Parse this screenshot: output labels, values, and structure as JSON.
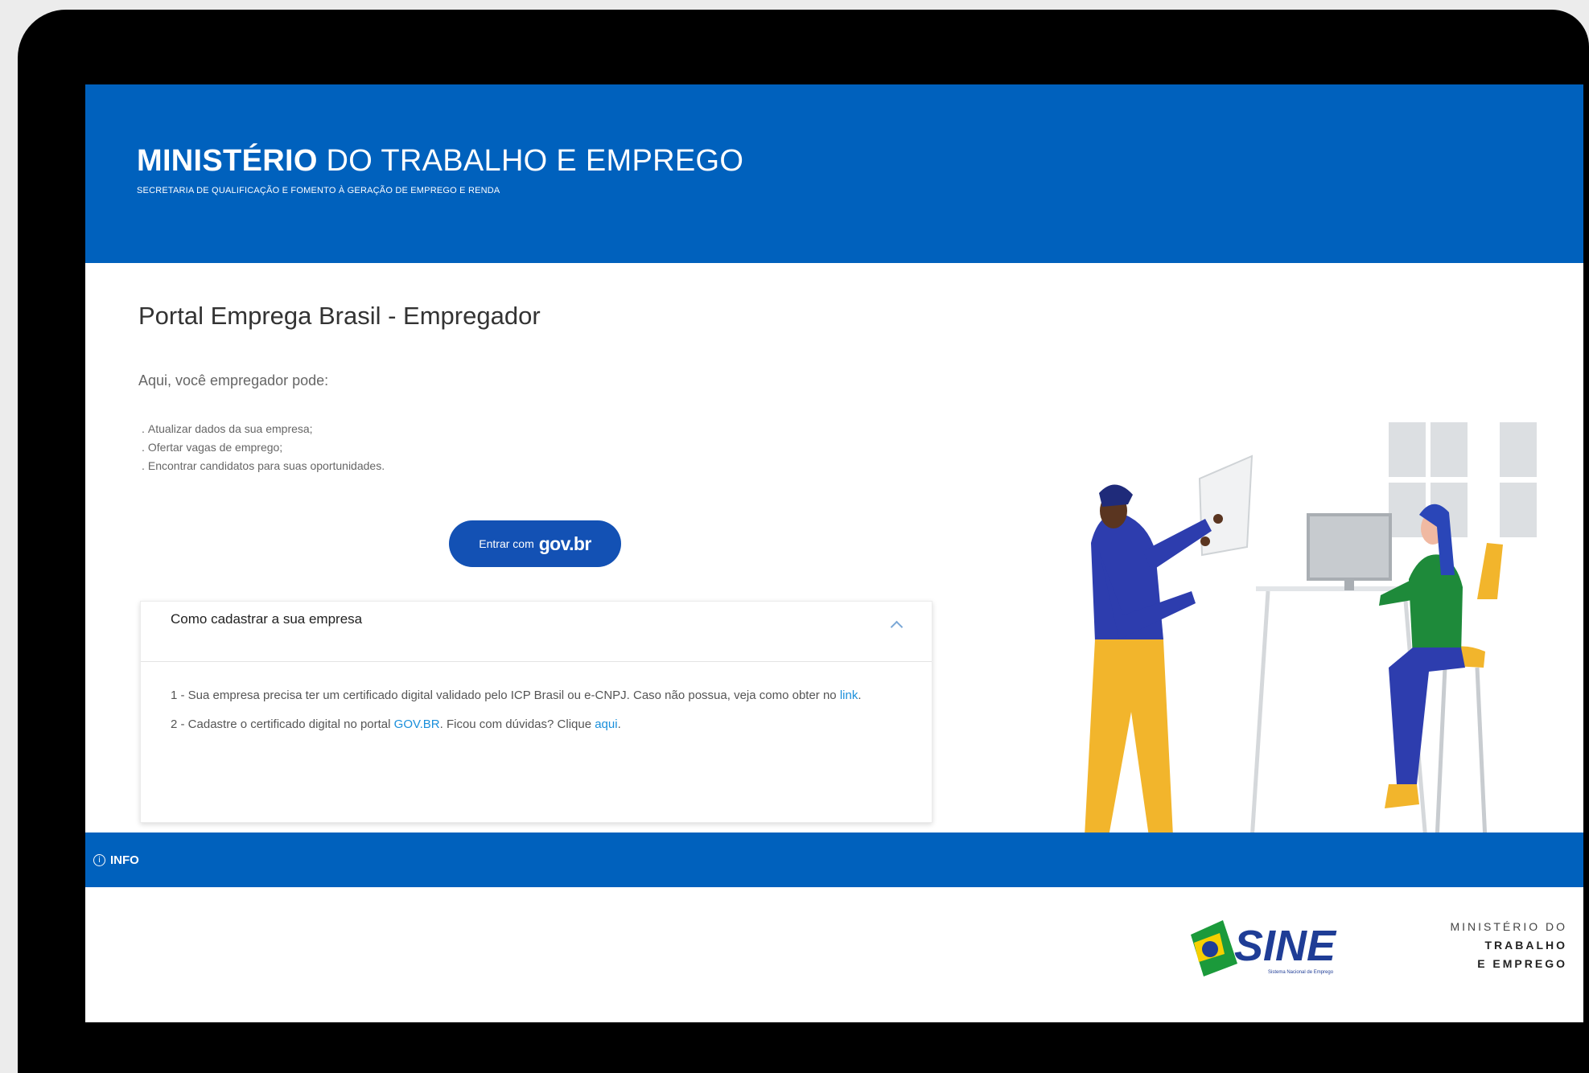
{
  "header": {
    "title_bold": "MINISTÉRIO",
    "title_rest": " DO TRABALHO E EMPREGO",
    "subtitle": "SECRETARIA DE QUALIFICAÇÃO E FOMENTO À GERAÇÃO DE EMPREGO E RENDA",
    "background_color": "#0061bd"
  },
  "main": {
    "page_title": "Portal Emprega Brasil - Empregador",
    "intro": "Aqui, você empregador pode:",
    "features": [
      "Atualizar dados da sua empresa;",
      "Ofertar vagas de emprego;",
      "Encontrar candidatos para suas oportunidades."
    ],
    "login_button": {
      "label": "Entrar com",
      "brand": "gov.br",
      "color": "#1351b4"
    }
  },
  "accordion": {
    "title": "Como cadastrar a sua empresa",
    "expanded": true,
    "step1_text": "1 - Sua empresa precisa ter um certificado digital validado pelo ICP Brasil ou e-CNPJ. Caso não possua, veja como obter no ",
    "step1_link": "link",
    "step1_end": ".",
    "step2_text": "2 - Cadastre o certificado digital no portal ",
    "step2_link1": "GOV.BR",
    "step2_mid": ". Ficou com dúvidas? Clique ",
    "step2_link2": "aqui",
    "step2_end": ".",
    "link_color": "#1a8fdb"
  },
  "info_bar": {
    "icon": "info-icon",
    "icon_glyph": "i",
    "label": "INFO"
  },
  "footer": {
    "sine_logo_text": "SINE",
    "sine_logo_subtitle": "Sistema Nacional de Emprego",
    "ministry_logo": [
      "MINISTÉRIO DO",
      "TRABALHO",
      "E EMPREGO"
    ]
  }
}
